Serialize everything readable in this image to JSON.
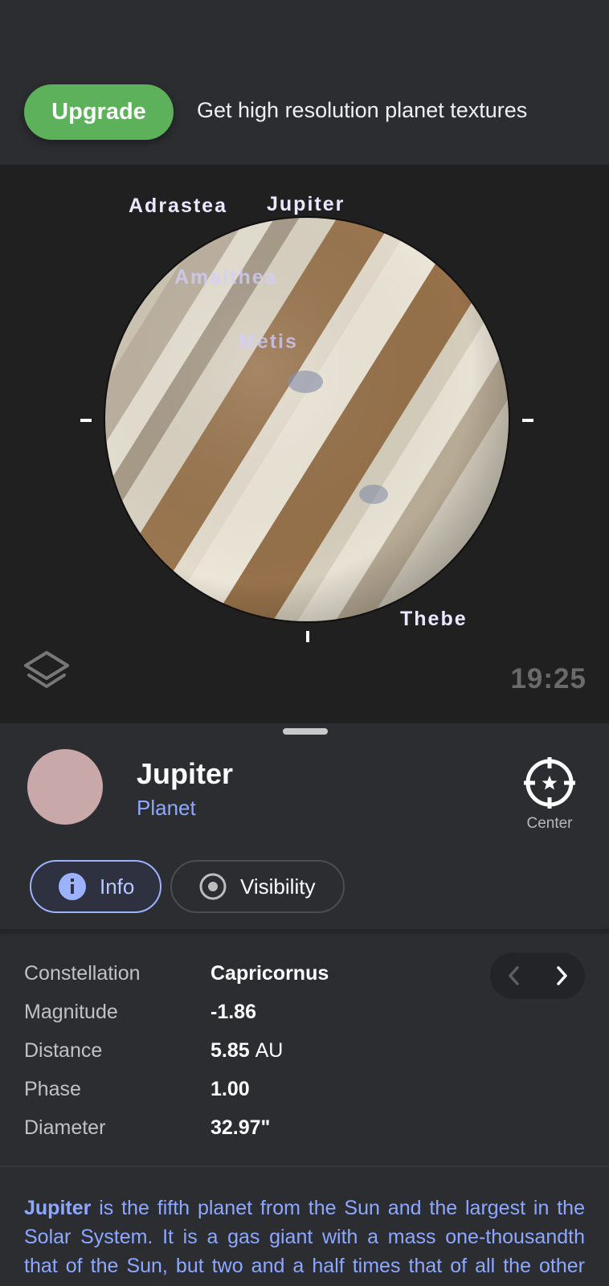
{
  "promo": {
    "button_label": "Upgrade",
    "text": "Get high resolution planet textures"
  },
  "sky": {
    "labels": {
      "adrastea": "Adrastea",
      "jupiter": "Jupiter",
      "amalthea": "Amalthea",
      "metis": "Metis",
      "thebe": "Thebe"
    },
    "time": "19:25"
  },
  "object": {
    "name": "Jupiter",
    "type": "Planet",
    "swatch_color": "#c8a8a8",
    "center_label": "Center"
  },
  "tabs": [
    {
      "label": "Info",
      "icon": "info-icon",
      "active": true
    },
    {
      "label": "Visibility",
      "icon": "target-icon",
      "active": false
    }
  ],
  "details": [
    {
      "key": "Constellation",
      "value": "Capricornus",
      "unit": ""
    },
    {
      "key": "Magnitude",
      "value": "-1.86",
      "unit": ""
    },
    {
      "key": "Distance",
      "value": "5.85",
      "unit": "AU"
    },
    {
      "key": "Phase",
      "value": "1.00",
      "unit": ""
    },
    {
      "key": "Diameter",
      "value": "32.97\"",
      "unit": ""
    }
  ],
  "description": {
    "bold": "Jupiter",
    "text": " is the fifth planet from the Sun and the largest in the Solar System. It is a gas giant with a mass one-thousandth that of the Sun, but two and a half times that of all the other planets in the Solar System combined."
  },
  "colors": {
    "accent": "#8ea8ff",
    "upgrade": "#5cb15a",
    "sheet_bg": "#2b2d31",
    "sky_bg": "#202020"
  }
}
